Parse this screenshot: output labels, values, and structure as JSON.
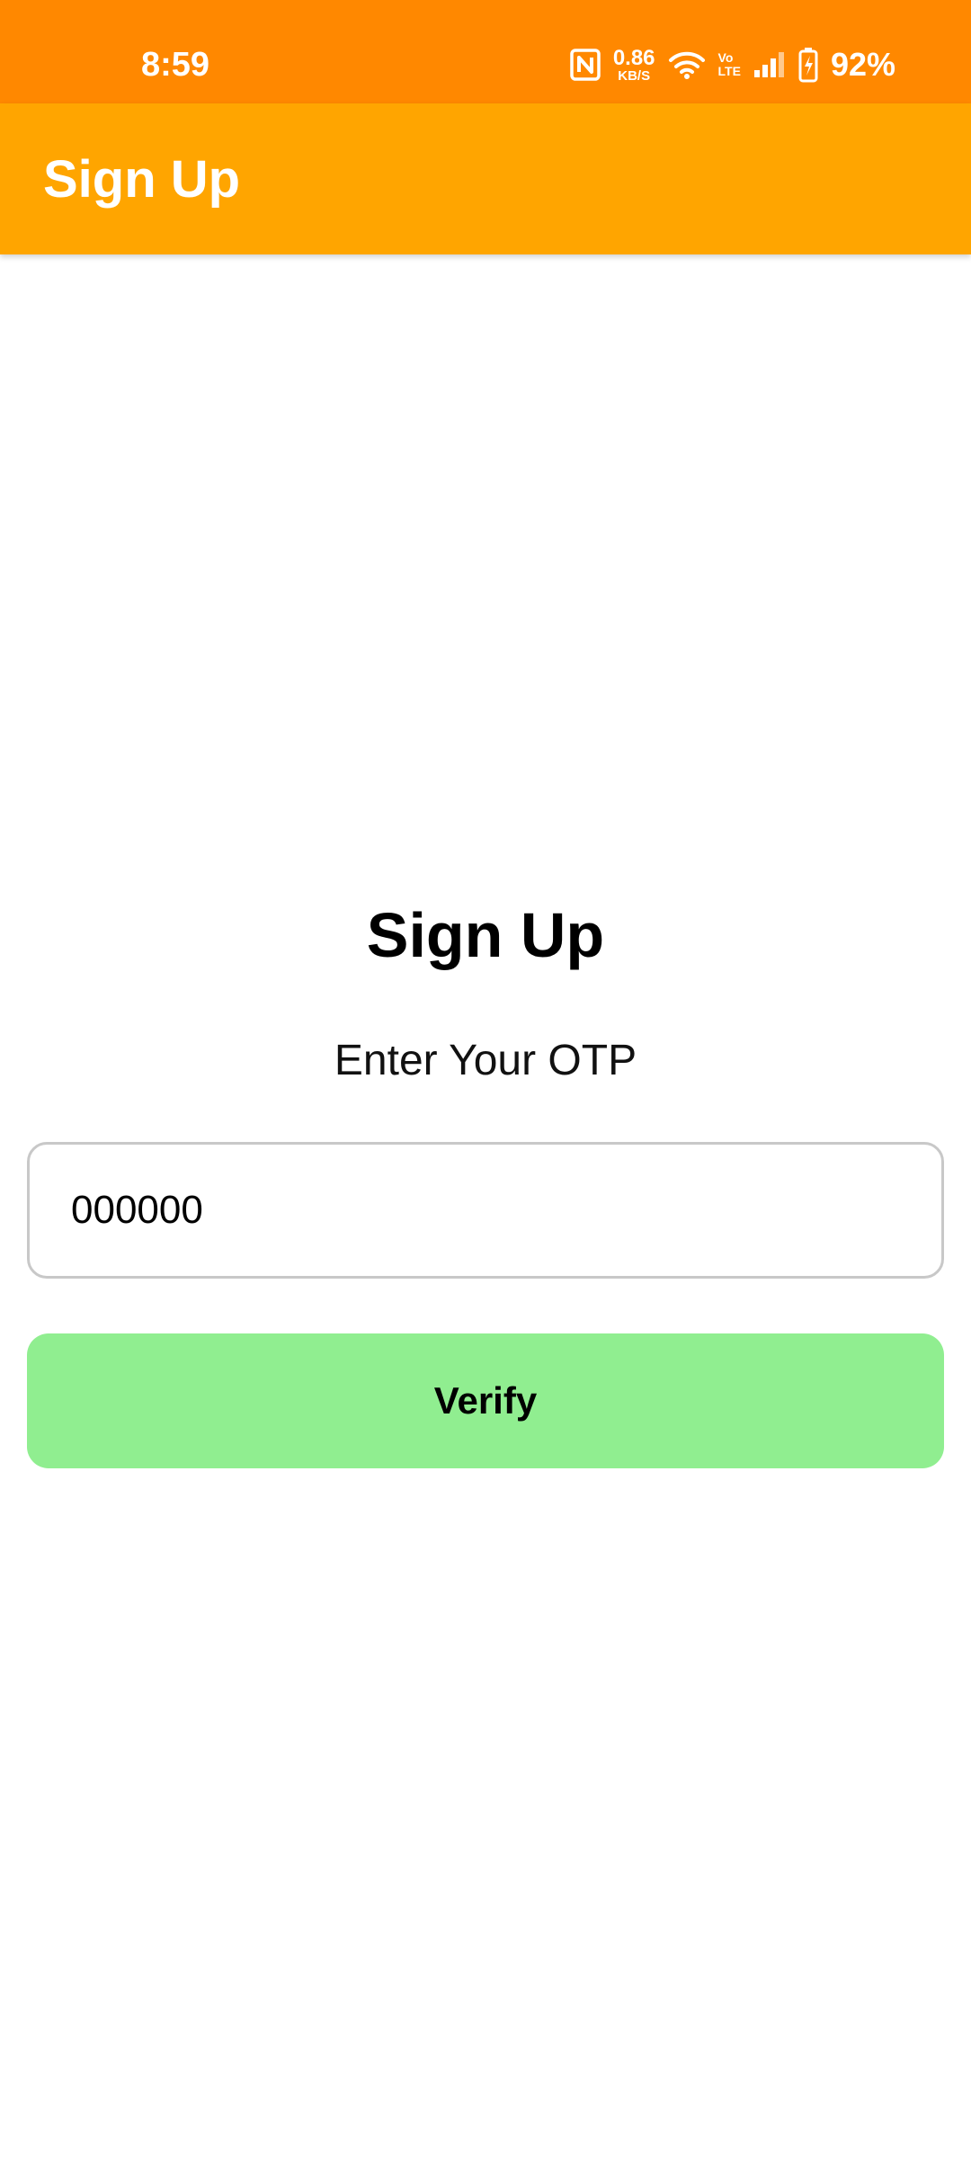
{
  "status_bar": {
    "time": "8:59",
    "network_speed_value": "0.86",
    "network_speed_unit": "KB/S",
    "volte_top": "Vo",
    "volte_bottom": "LTE",
    "battery_percent": "92%",
    "icons": [
      "nfc-icon",
      "wifi-icon",
      "signal-icon",
      "battery-icon"
    ]
  },
  "app_bar": {
    "title": "Sign Up"
  },
  "form": {
    "heading": "Sign Up",
    "subheading": "Enter Your OTP",
    "otp_value": "000000",
    "verify_label": "Verify"
  },
  "colors": {
    "status_bar": "#FF8800",
    "app_bar": "#FFA500",
    "verify_button": "#90EE90"
  }
}
